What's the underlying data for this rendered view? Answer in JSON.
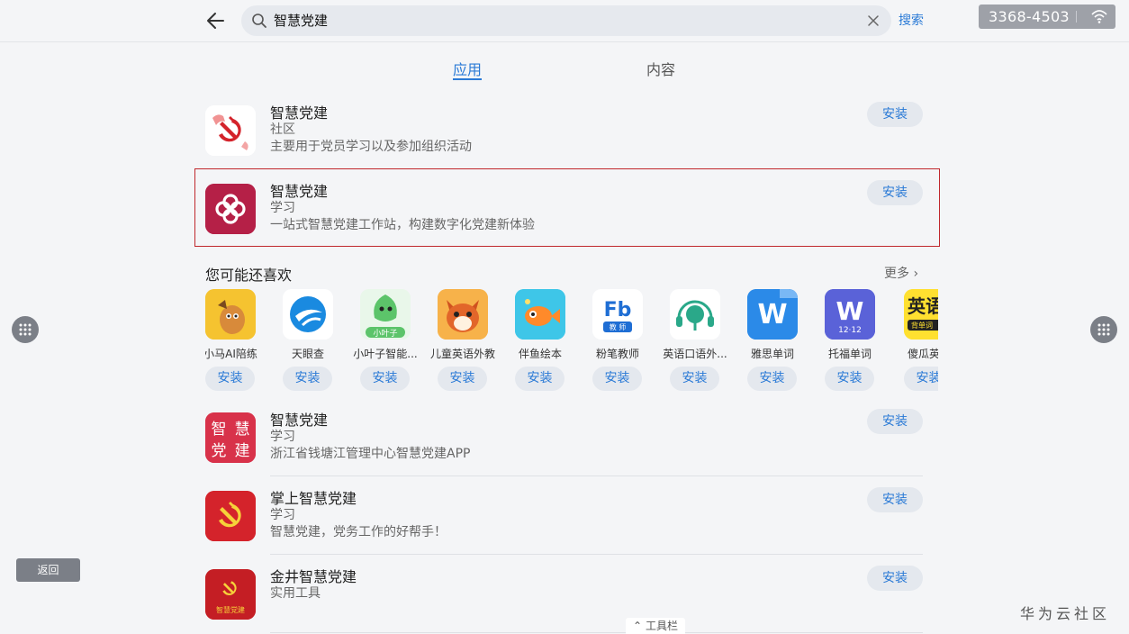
{
  "search": {
    "query": "智慧党建",
    "button": "搜索"
  },
  "status": {
    "number": "3368-4503"
  },
  "tabs": [
    {
      "label": "应用"
    },
    {
      "label": "内容"
    }
  ],
  "results": [
    {
      "name": "智慧党建",
      "category": "社区",
      "desc": "主要用于党员学习以及参加组织活动",
      "install": "安装"
    },
    {
      "name": "智慧党建",
      "category": "学习",
      "desc": "一站式智慧党建工作站，构建数字化党建新体验",
      "install": "安装"
    }
  ],
  "recommend": {
    "title": "您可能还喜欢",
    "more": "更多",
    "items": [
      {
        "name": "小马AI陪练",
        "install": "安装"
      },
      {
        "name": "天眼查",
        "install": "安装"
      },
      {
        "name": "小叶子智能...",
        "install": "安装"
      },
      {
        "name": "儿童英语外教",
        "install": "安装"
      },
      {
        "name": "伴鱼绘本",
        "install": "安装"
      },
      {
        "name": "粉笔教师",
        "install": "安装"
      },
      {
        "name": "英语口语外...",
        "install": "安装"
      },
      {
        "name": "雅思单词",
        "install": "安装"
      },
      {
        "name": "托福单词",
        "install": "安装"
      },
      {
        "name": "傻瓜英语",
        "install": "安装"
      }
    ]
  },
  "results2": [
    {
      "name": "智慧党建",
      "category": "学习",
      "desc": "浙江省钱塘江管理中心智慧党建APP",
      "install": "安装"
    },
    {
      "name": "掌上智慧党建",
      "category": "学习",
      "desc": "智慧党建，党务工作的好帮手！",
      "install": "安装"
    },
    {
      "name": "金井智慧党建",
      "category": "实用工具",
      "desc": "",
      "install": "安装"
    }
  ],
  "icon_text": {
    "zhihui_grid": [
      "智",
      "慧",
      "党",
      "建"
    ],
    "xiaoyezi": "小叶子",
    "fenbi_letters": "Fb",
    "fenbi_sub": "教 师",
    "w_letter": "W",
    "tuofu_sub": "12·12",
    "shagua": "英语",
    "shagua_sub": "背单词",
    "jinjing_sub": "智慧党建"
  },
  "side": {
    "return": "返回",
    "toolbar": "工具栏"
  },
  "watermark": "华为云社区",
  "colors": {
    "accent": "#2a7ad6",
    "highlight": "#c0282d"
  }
}
